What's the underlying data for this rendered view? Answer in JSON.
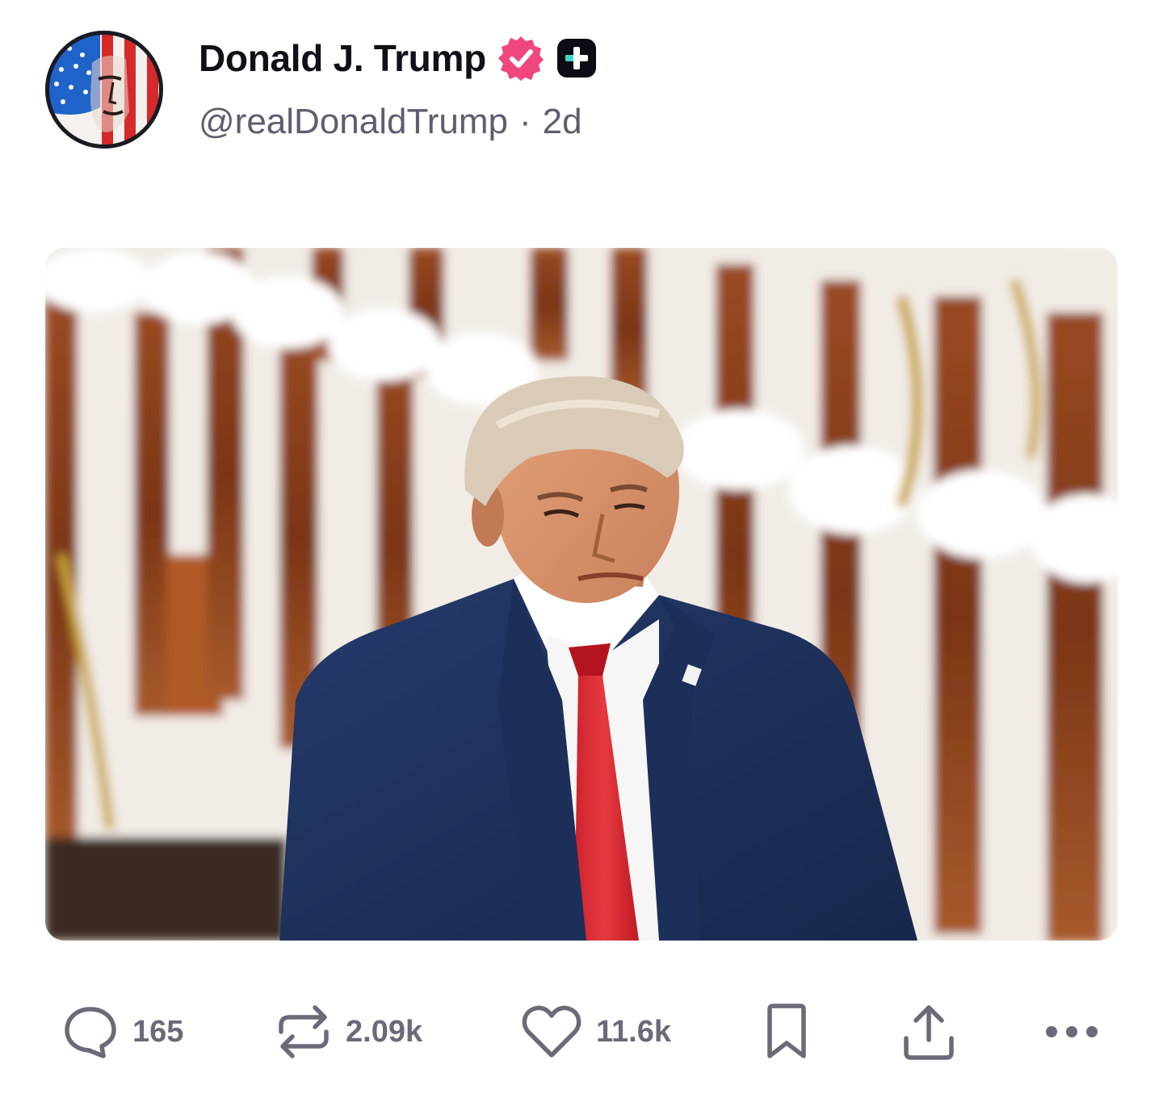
{
  "post": {
    "author": {
      "display_name": "Donald J. Trump",
      "handle": "@realDonaldTrump",
      "verified_icon": "verified-badge-icon",
      "plus_icon": "plus-badge-icon"
    },
    "meta_separator": "·",
    "age": "2d",
    "media": {
      "description_icon": "photo"
    },
    "stats": {
      "replies": "165",
      "reposts": "2.09k",
      "likes": "11.6k"
    }
  },
  "colors": {
    "verified": "#f0467e",
    "icon_gray": "#6c6a79",
    "text_dark": "#101018",
    "text_muted": "#5f5d6e"
  }
}
